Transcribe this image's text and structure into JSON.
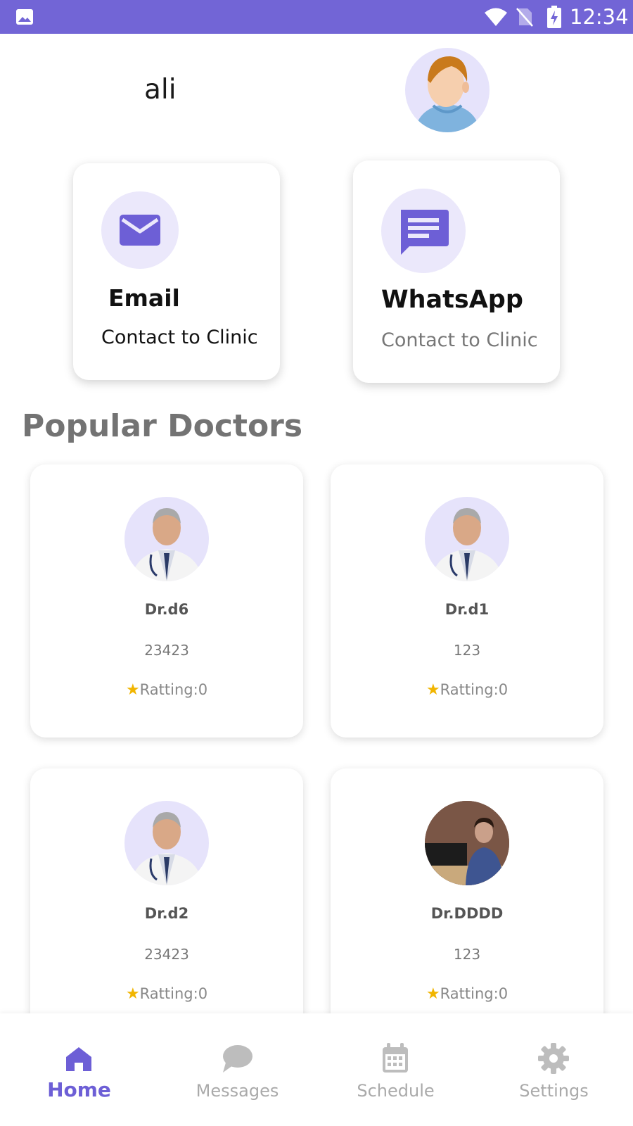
{
  "status_bar": {
    "time": "12:34"
  },
  "header": {
    "user_name": "ali"
  },
  "contacts": [
    {
      "title": "Email",
      "subtitle": "Contact to Clinic",
      "icon": "mail-icon"
    },
    {
      "title": "WhatsApp",
      "subtitle": "Contact to Clinic",
      "icon": "message-icon"
    }
  ],
  "section_title": "Popular Doctors",
  "doctors": [
    {
      "name": "Dr.d6",
      "phone": "23423",
      "rating": "Ratting:0"
    },
    {
      "name": "Dr.d1",
      "phone": "123",
      "rating": "Ratting:0"
    },
    {
      "name": "Dr.d2",
      "phone": "23423",
      "rating": "Ratting:0"
    },
    {
      "name": "Dr.DDDD",
      "phone": "123",
      "rating": "Ratting:0"
    }
  ],
  "bottom_nav": {
    "items": [
      {
        "label": "Home",
        "icon": "home-icon",
        "active": true
      },
      {
        "label": "Messages",
        "icon": "chat-bubble-icon",
        "active": false
      },
      {
        "label": "Schedule",
        "icon": "calendar-icon",
        "active": false
      },
      {
        "label": "Settings",
        "icon": "gear-icon",
        "active": false
      }
    ]
  },
  "colors": {
    "accent": "#7265d6",
    "icon_bg": "#ebe8fb",
    "star": "#f1b500",
    "nav_inactive": "#aaaaaa"
  }
}
